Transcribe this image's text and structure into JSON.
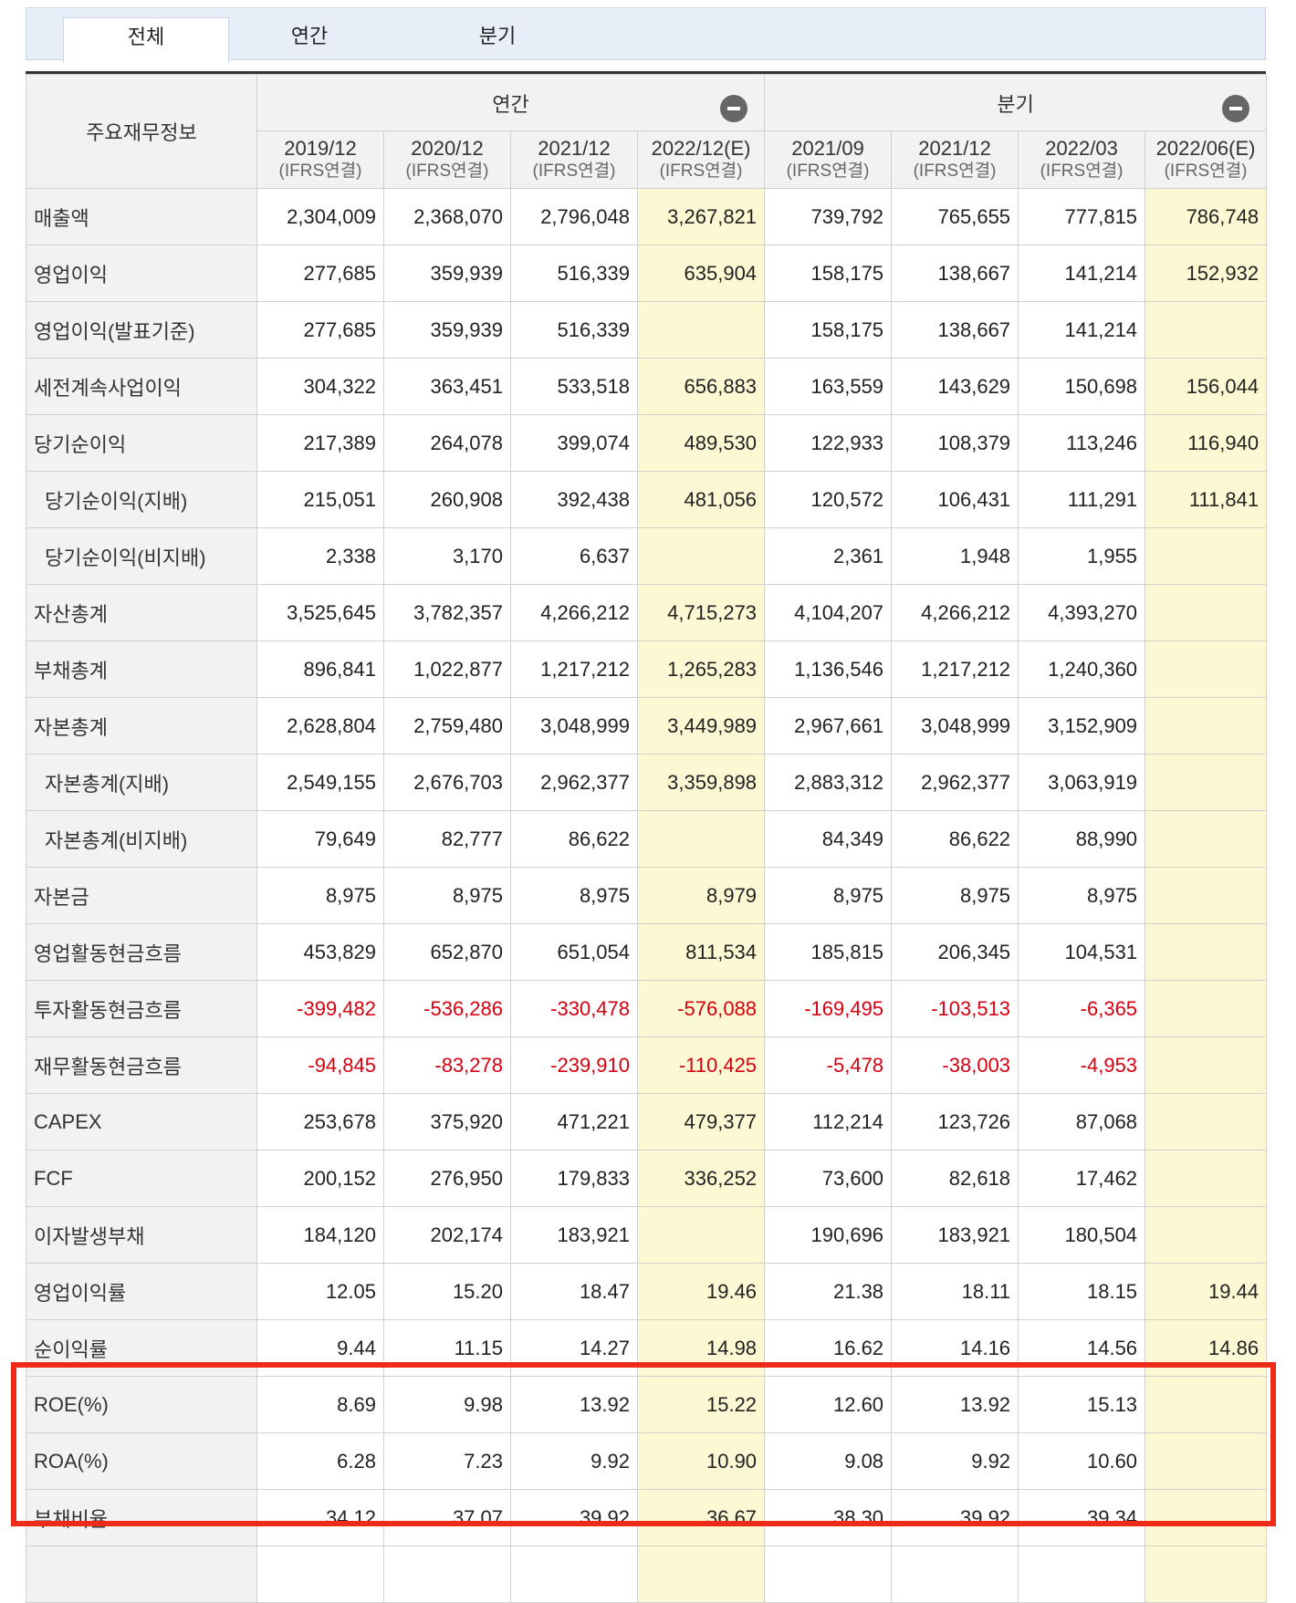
{
  "tabs": [
    "전체",
    "연간",
    "분기"
  ],
  "table": {
    "row_header_title": "주요재무정보",
    "groups": [
      "연간",
      "분기"
    ],
    "periods": [
      {
        "label": "2019/12",
        "basis": "(IFRS연결)"
      },
      {
        "label": "2020/12",
        "basis": "(IFRS연결)"
      },
      {
        "label": "2021/12",
        "basis": "(IFRS연결)"
      },
      {
        "label": "2022/12(E)",
        "basis": "(IFRS연결)"
      },
      {
        "label": "2021/09",
        "basis": "(IFRS연결)"
      },
      {
        "label": "2021/12",
        "basis": "(IFRS연결)"
      },
      {
        "label": "2022/03",
        "basis": "(IFRS연결)"
      },
      {
        "label": "2022/06(E)",
        "basis": "(IFRS연결)"
      }
    ],
    "rows": [
      {
        "label": "매출액",
        "values": [
          "2,304,009",
          "2,368,070",
          "2,796,048",
          "3,267,821",
          "739,792",
          "765,655",
          "777,815",
          "786,748"
        ]
      },
      {
        "label": "영업이익",
        "values": [
          "277,685",
          "359,939",
          "516,339",
          "635,904",
          "158,175",
          "138,667",
          "141,214",
          "152,932"
        ]
      },
      {
        "label": "영업이익(발표기준)",
        "values": [
          "277,685",
          "359,939",
          "516,339",
          "",
          "158,175",
          "138,667",
          "141,214",
          ""
        ]
      },
      {
        "label": "세전계속사업이익",
        "values": [
          "304,322",
          "363,451",
          "533,518",
          "656,883",
          "163,559",
          "143,629",
          "150,698",
          "156,044"
        ]
      },
      {
        "label": "당기순이익",
        "values": [
          "217,389",
          "264,078",
          "399,074",
          "489,530",
          "122,933",
          "108,379",
          "113,246",
          "116,940"
        ]
      },
      {
        "label": "당기순이익(지배)",
        "values": [
          "215,051",
          "260,908",
          "392,438",
          "481,056",
          "120,572",
          "106,431",
          "111,291",
          "111,841"
        ]
      },
      {
        "label": "당기순이익(비지배)",
        "values": [
          "2,338",
          "3,170",
          "6,637",
          "",
          "2,361",
          "1,948",
          "1,955",
          ""
        ]
      },
      {
        "label": "자산총계",
        "values": [
          "3,525,645",
          "3,782,357",
          "4,266,212",
          "4,715,273",
          "4,104,207",
          "4,266,212",
          "4,393,270",
          ""
        ]
      },
      {
        "label": "부채총계",
        "values": [
          "896,841",
          "1,022,877",
          "1,217,212",
          "1,265,283",
          "1,136,546",
          "1,217,212",
          "1,240,360",
          ""
        ]
      },
      {
        "label": "자본총계",
        "values": [
          "2,628,804",
          "2,759,480",
          "3,048,999",
          "3,449,989",
          "2,967,661",
          "3,048,999",
          "3,152,909",
          ""
        ]
      },
      {
        "label": "자본총계(지배)",
        "values": [
          "2,549,155",
          "2,676,703",
          "2,962,377",
          "3,359,898",
          "2,883,312",
          "2,962,377",
          "3,063,919",
          ""
        ]
      },
      {
        "label": "자본총계(비지배)",
        "values": [
          "79,649",
          "82,777",
          "86,622",
          "",
          "84,349",
          "86,622",
          "88,990",
          ""
        ]
      },
      {
        "label": "자본금",
        "values": [
          "8,975",
          "8,975",
          "8,975",
          "8,979",
          "8,975",
          "8,975",
          "8,975",
          ""
        ]
      },
      {
        "label": "영업활동현금흐름",
        "values": [
          "453,829",
          "652,870",
          "651,054",
          "811,534",
          "185,815",
          "206,345",
          "104,531",
          ""
        ]
      },
      {
        "label": "투자활동현금흐름",
        "values": [
          "-399,482",
          "-536,286",
          "-330,478",
          "-576,088",
          "-169,495",
          "-103,513",
          "-6,365",
          ""
        ]
      },
      {
        "label": "재무활동현금흐름",
        "values": [
          "-94,845",
          "-83,278",
          "-239,910",
          "-110,425",
          "-5,478",
          "-38,003",
          "-4,953",
          ""
        ]
      },
      {
        "label": "CAPEX",
        "values": [
          "253,678",
          "375,920",
          "471,221",
          "479,377",
          "112,214",
          "123,726",
          "87,068",
          ""
        ]
      },
      {
        "label": "FCF",
        "values": [
          "200,152",
          "276,950",
          "179,833",
          "336,252",
          "73,600",
          "82,618",
          "17,462",
          ""
        ]
      },
      {
        "label": "이자발생부채",
        "values": [
          "184,120",
          "202,174",
          "183,921",
          "",
          "190,696",
          "183,921",
          "180,504",
          ""
        ]
      },
      {
        "label": "영업이익률",
        "values": [
          "12.05",
          "15.20",
          "18.47",
          "19.46",
          "21.38",
          "18.11",
          "18.15",
          "19.44"
        ]
      },
      {
        "label": "순이익률",
        "values": [
          "9.44",
          "11.15",
          "14.27",
          "14.98",
          "16.62",
          "14.16",
          "14.56",
          "14.86"
        ]
      },
      {
        "label": "ROE(%)",
        "values": [
          "8.69",
          "9.98",
          "13.92",
          "15.22",
          "12.60",
          "13.92",
          "15.13",
          ""
        ]
      },
      {
        "label": "ROA(%)",
        "values": [
          "6.28",
          "7.23",
          "9.92",
          "10.90",
          "9.08",
          "9.92",
          "10.60",
          ""
        ]
      },
      {
        "label": "부채비율",
        "values": [
          "34.12",
          "37.07",
          "39.92",
          "36.67",
          "38.30",
          "39.92",
          "39.34",
          ""
        ]
      },
      {
        "label": "",
        "values": [
          "",
          "",
          "",
          "",
          "",
          "",
          "",
          ""
        ]
      }
    ]
  },
  "colors": {
    "estimate_bg": "#fdf8d4",
    "negative": "#d7000f",
    "header_bg": "#f2f2f2",
    "highlight": "#ee2a18"
  }
}
